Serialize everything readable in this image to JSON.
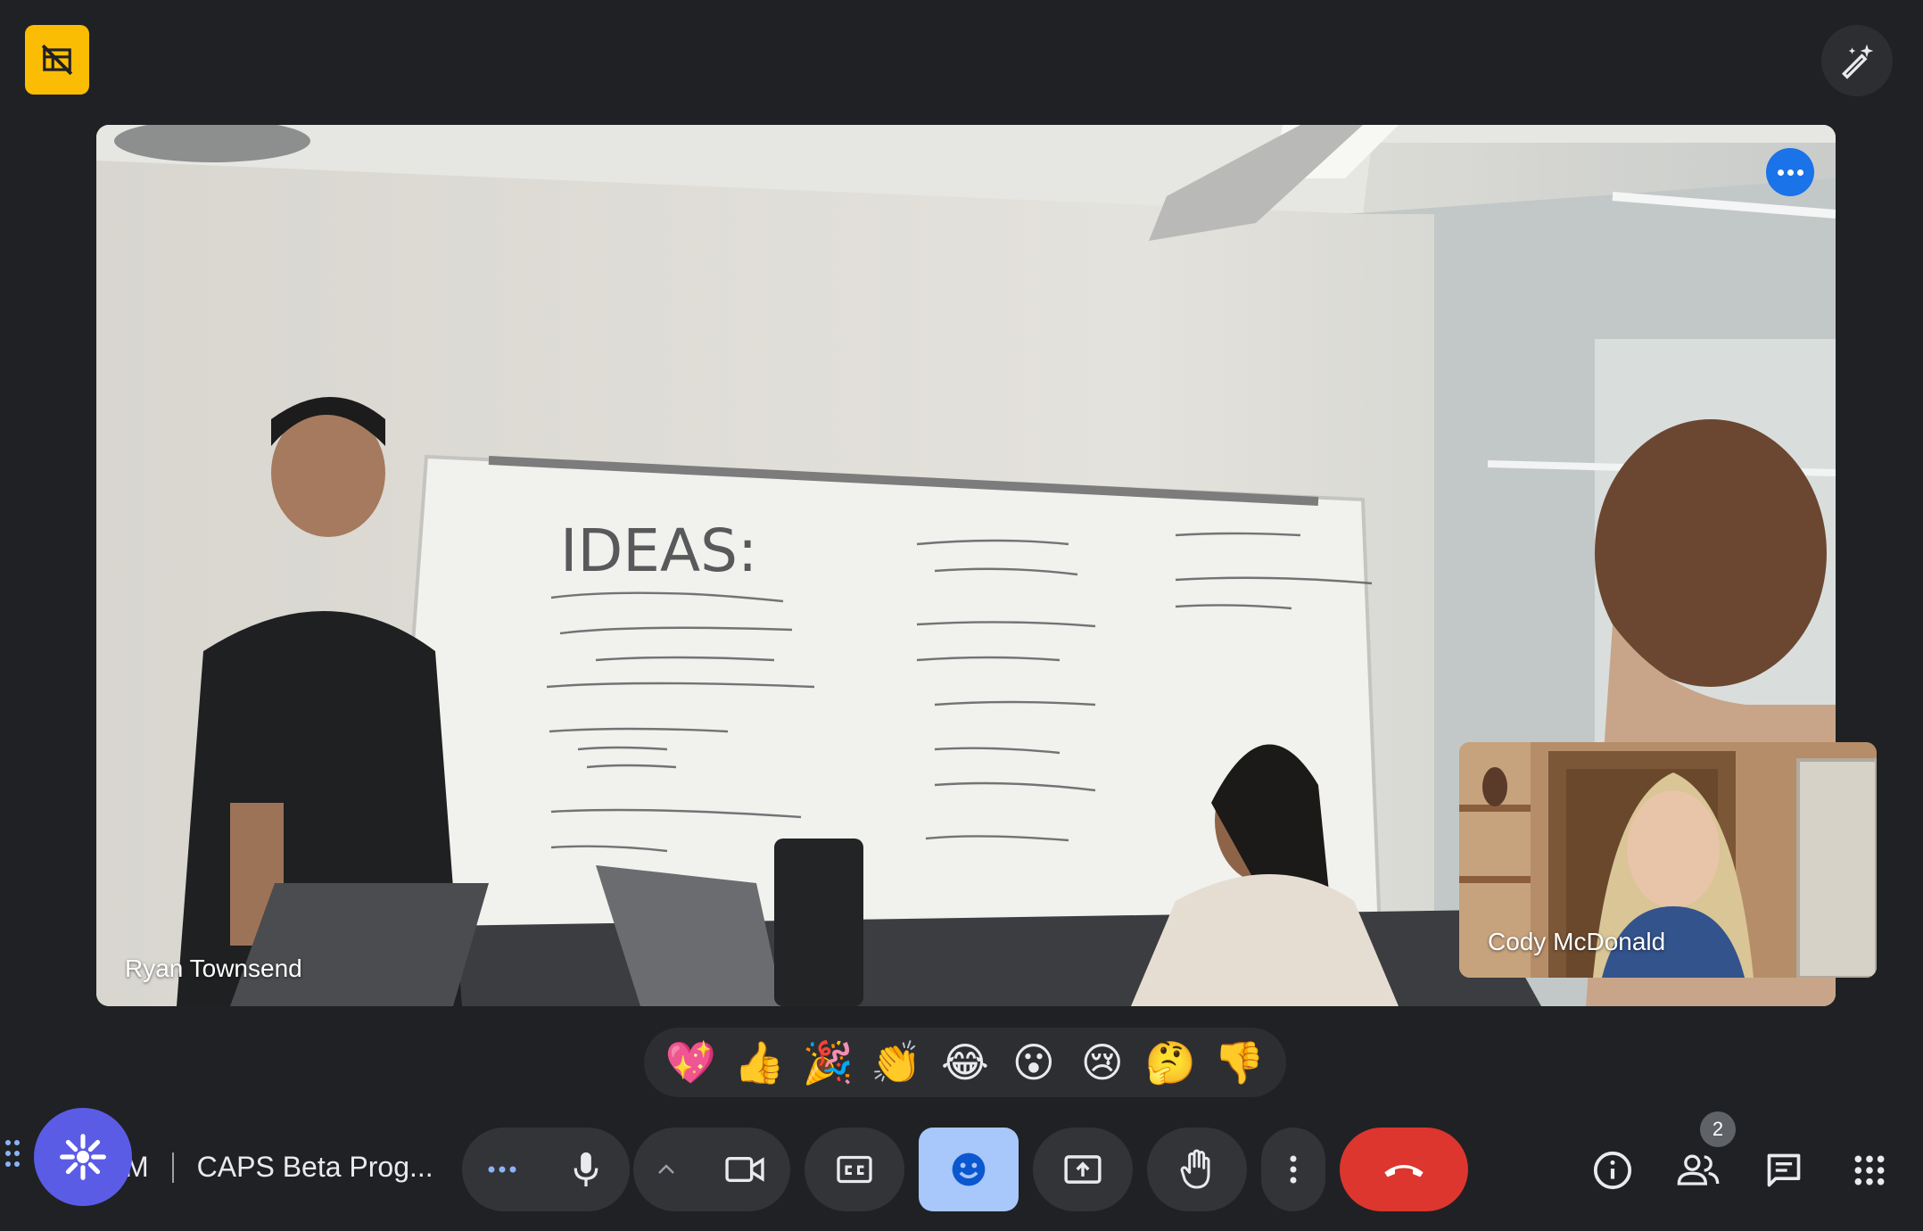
{
  "main_video": {
    "participant_name": "Ryan Townsend",
    "more_options_icon": "more-horizontal-icon"
  },
  "pip_video": {
    "participant_name": "Cody McDonald"
  },
  "whiteboard": {
    "heading": "IDEAS:"
  },
  "top_bar": {
    "left_icon": "no-video-layout-icon",
    "right_icon": "visual-effects-pen-icon",
    "left_color": "#fbbc04"
  },
  "reactions": [
    {
      "emoji": "💖",
      "name": "sparkling-heart"
    },
    {
      "emoji": "👍",
      "name": "thumbs-up"
    },
    {
      "emoji": "🎉",
      "name": "party-popper"
    },
    {
      "emoji": "👏",
      "name": "clapping-hands"
    },
    {
      "emoji": "😂",
      "name": "tears-of-joy"
    },
    {
      "emoji": "😮",
      "name": "surprised"
    },
    {
      "emoji": "😢",
      "name": "crying"
    },
    {
      "emoji": "🤔",
      "name": "thinking"
    },
    {
      "emoji": "👎",
      "name": "thumbs-down"
    }
  ],
  "meeting": {
    "time_tail": "M",
    "title": "CAPS Beta Prog..."
  },
  "controls": {
    "more_reactions": "more-dots-icon",
    "mic": "mic-icon",
    "camera_options": "chevron-up-icon",
    "camera": "videocam-icon",
    "captions": "closed-captions-icon",
    "emoji": "emoji-icon",
    "present": "present-screen-icon",
    "raise_hand": "hand-icon",
    "more_options": "more-vertical-icon",
    "leave": "call-end-icon"
  },
  "right_controls": {
    "info": "info-icon",
    "people": "people-icon",
    "people_count": "2",
    "chat": "chat-icon",
    "activities": "apps-grid-icon"
  },
  "colors": {
    "background": "#202124",
    "accent": "#1a73e8",
    "active_control": "#a8c7fa",
    "leave": "#dc362e",
    "gemini": "#5b5ce6"
  }
}
